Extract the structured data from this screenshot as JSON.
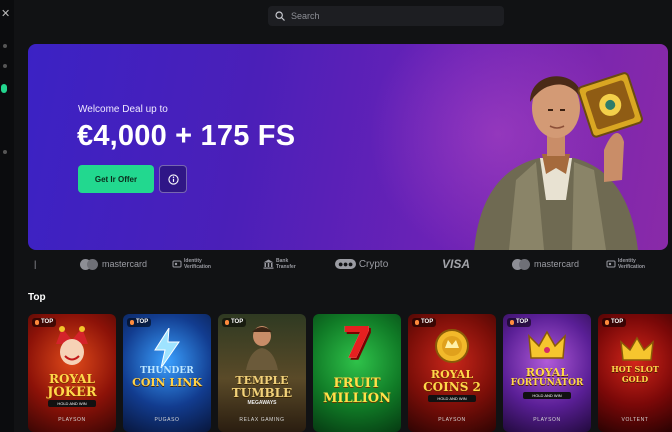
{
  "search": {
    "placeholder": "Search"
  },
  "hero": {
    "subtitle": "Welcome Deal up to",
    "title": "€4,000 + 175 FS",
    "cta_label": "Get Ir Offer"
  },
  "payments": [
    {
      "name": "mastercard",
      "label": "mastercard"
    },
    {
      "name": "identity-verification",
      "label": "Identity Verification"
    },
    {
      "name": "bank-transfer",
      "label": "Bank Transfer"
    },
    {
      "name": "crypto",
      "label": "Crypto"
    },
    {
      "name": "visa",
      "label": "VISA"
    },
    {
      "name": "mastercard-2",
      "label": "mastercard"
    },
    {
      "name": "identity-verification-2",
      "label": "Identity Verification"
    }
  ],
  "section": {
    "title": "Top"
  },
  "games": [
    {
      "badge": "TOP",
      "title_line1": "ROYAL",
      "title_line2": "JOKER",
      "tagline": "HOLD AND WIN",
      "provider": "PLAYSON"
    },
    {
      "badge": "TOP",
      "title_line1": "THUNDER",
      "title_line2": "COIN LINK",
      "tagline": "",
      "provider": "PUGASO"
    },
    {
      "badge": "TOP",
      "title_line1": "TEMPLE",
      "title_line2": "TUMBLE",
      "tagline": "MEGAWAYS",
      "provider": "RELAX GAMING"
    },
    {
      "badge": "TOP",
      "title_line1": "FRUIT",
      "title_line2": "MILLION",
      "tagline": "",
      "provider": ""
    },
    {
      "badge": "TOP",
      "title_line1": "ROYAL",
      "title_line2": "COINS 2",
      "tagline": "HOLD AND WIN",
      "provider": "PLAYSON"
    },
    {
      "badge": "TOP",
      "title_line1": "ROYAL",
      "title_line2": "FORTUNATOR",
      "tagline": "HOLD AND WIN",
      "provider": "PLAYSON"
    },
    {
      "badge": "TOP",
      "title_line1": "HOT SLOT",
      "title_line2": "GOLD",
      "tagline": "",
      "provider": "VOLTENT"
    }
  ],
  "colors": {
    "accent": "#22d88f",
    "hero_start": "#3b22c4",
    "hero_end": "#8a2aa8",
    "background": "#111214"
  }
}
